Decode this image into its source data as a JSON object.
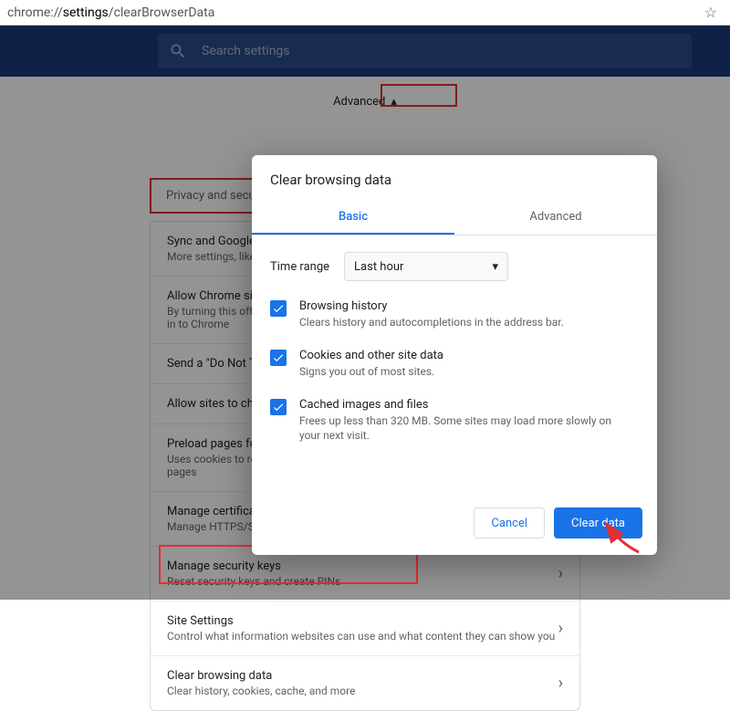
{
  "addressbar": {
    "prefix": "chrome://",
    "bold": "settings",
    "suffix": "/clearBrowserData"
  },
  "search_placeholder": "Search settings",
  "advanced_label": "Advanced",
  "section_title": "Privacy and security",
  "rows": [
    {
      "title": "Sync and Google services",
      "sub": "More settings, like sync",
      "type": "chev"
    },
    {
      "title": "Allow Chrome sign-in",
      "sub": "By turning this off, you can sign in to Google sites like Gmail without signing in to Chrome",
      "type": "toggle-on"
    },
    {
      "title": "Send a \"Do Not Track\" request with your browsing traffic",
      "sub": "",
      "type": "toggle-off"
    },
    {
      "title": "Allow sites to check if you have payment methods saved",
      "sub": "",
      "type": "toggle-on"
    },
    {
      "title": "Preload pages for faster browsing and searching",
      "sub": "Uses cookies to remember your preferences, even if you don't visit those pages",
      "type": "toggle-on"
    },
    {
      "title": "Manage certificates",
      "sub": "Manage HTTPS/SSL certificates and settings",
      "type": "ext"
    },
    {
      "title": "Manage security keys",
      "sub": "Reset security keys and create PINs",
      "type": "chev"
    },
    {
      "title": "Site Settings",
      "sub": "Control what information websites can use and what content they can show you",
      "type": "chev"
    },
    {
      "title": "Clear browsing data",
      "sub": "Clear history, cookies, cache, and more",
      "type": "chev"
    }
  ],
  "dialog": {
    "title": "Clear browsing data",
    "tab_basic": "Basic",
    "tab_advanced": "Advanced",
    "time_label": "Time range",
    "time_value": "Last hour",
    "opts": [
      {
        "title": "Browsing history",
        "desc": "Clears history and autocompletions in the address bar."
      },
      {
        "title": "Cookies and other site data",
        "desc": "Signs you out of most sites."
      },
      {
        "title": "Cached images and files",
        "desc": "Frees up less than 320 MB. Some sites may load more slowly on your next visit."
      }
    ],
    "cancel": "Cancel",
    "clear": "Clear data"
  }
}
